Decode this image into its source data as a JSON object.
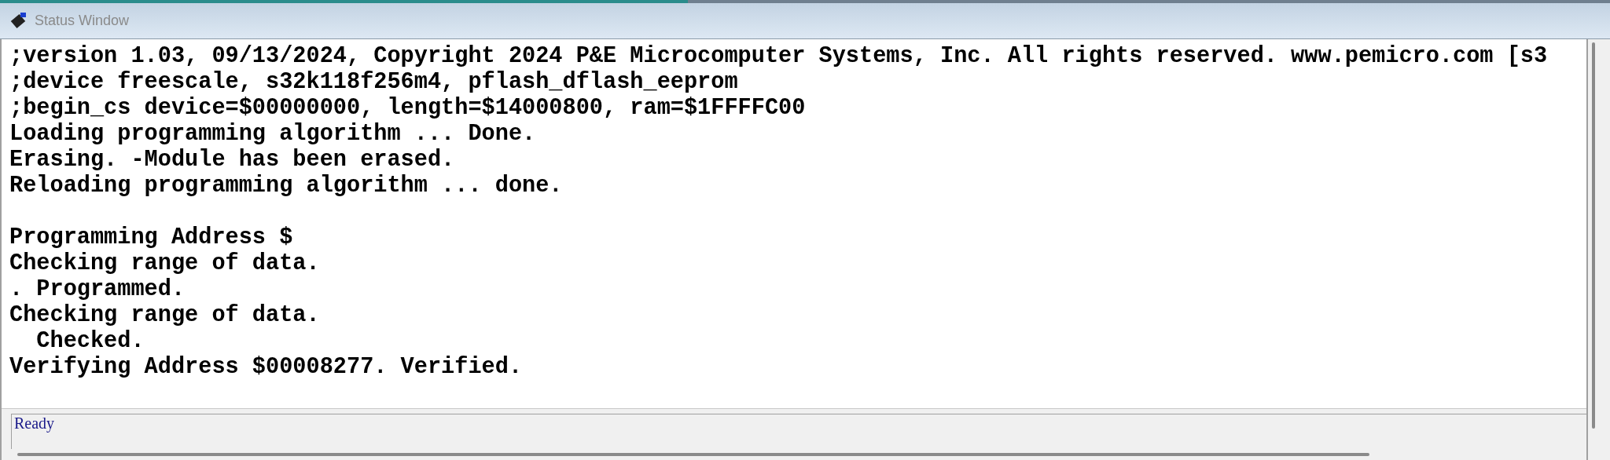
{
  "window": {
    "title": "Status Window"
  },
  "output": {
    "blocks": [
      [
        ";version 1.03, 09/13/2024, Copyright 2024 P&E Microcomputer Systems, Inc. All rights reserved. www.pemicro.com [s3",
        ";device freescale, s32k118f256m4, pflash_dflash_eeprom",
        ";begin_cs device=$00000000, length=$14000800, ram=$1FFFFC00",
        "Loading programming algorithm ... Done.",
        "Erasing. -Module has been erased.",
        "Reloading programming algorithm ... done."
      ],
      [
        "Programming Address $",
        "Checking range of data.",
        ". Programmed.",
        "Checking range of data.",
        "  Checked.",
        "Verifying Address $00008277. Verified."
      ]
    ]
  },
  "status_bar": {
    "text": "Ready"
  }
}
